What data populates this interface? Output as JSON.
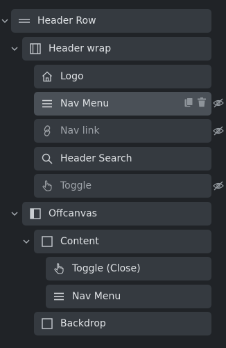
{
  "nodes": [
    {
      "label": "Header Row",
      "icon": "section-lines-icon"
    },
    {
      "label": "Header wrap",
      "icon": "container-icon"
    },
    {
      "label": "Logo",
      "icon": "home-icon"
    },
    {
      "label": "Nav Menu",
      "icon": "menu-icon"
    },
    {
      "label": "Nav link",
      "icon": "link-icon"
    },
    {
      "label": "Header Search",
      "icon": "search-icon"
    },
    {
      "label": "Toggle",
      "icon": "hand-pointer-icon"
    },
    {
      "label": "Offcanvas",
      "icon": "offcanvas-icon"
    },
    {
      "label": "Content",
      "icon": "square-icon"
    },
    {
      "label": "Toggle (Close)",
      "icon": "hand-pointer-icon"
    },
    {
      "label": "Nav Menu",
      "icon": "menu-icon"
    },
    {
      "label": "Backdrop",
      "icon": "square-icon"
    }
  ],
  "colors": {
    "background": "#202327",
    "row": "#353a40",
    "row_selected": "#4a5057",
    "text": "#dfe2e5",
    "text_dim": "#9ea3a9"
  }
}
